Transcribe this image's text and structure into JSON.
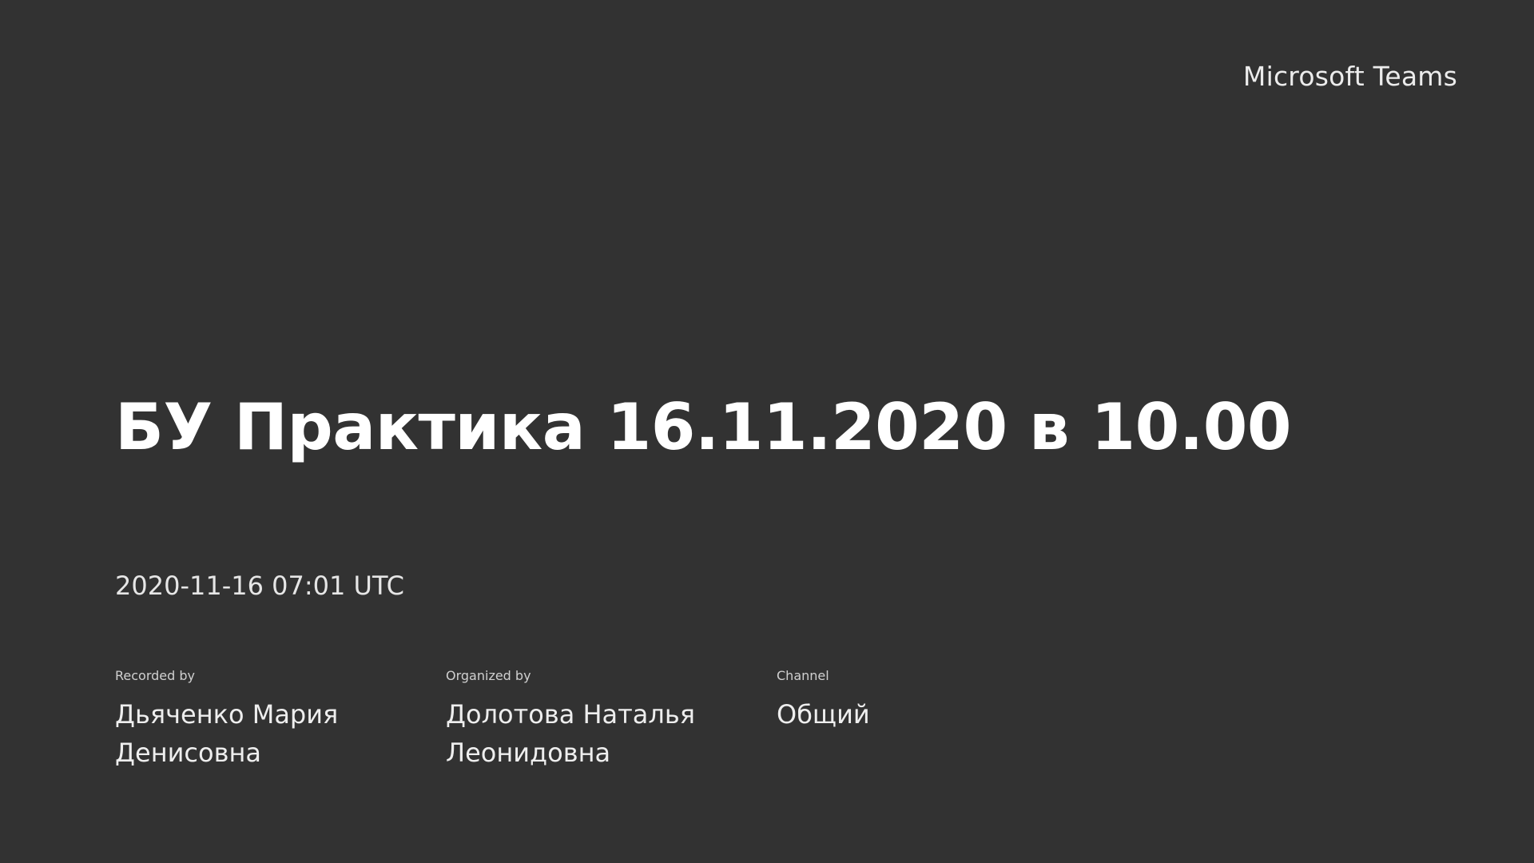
{
  "brand": "Microsoft Teams",
  "meeting": {
    "title": "БУ Практика 16.11.2020 в 10.00",
    "datetime": "2020-11-16 07:01 UTC"
  },
  "details": [
    {
      "label": "Recorded by",
      "value": "Дьяченко Мария Денисовна"
    },
    {
      "label": "Organized by",
      "value": "Долотова Наталья Леонидовна"
    },
    {
      "label": "Channel",
      "value": "Общий"
    }
  ],
  "colors": {
    "background": "#323232",
    "text": "#ffffff"
  }
}
